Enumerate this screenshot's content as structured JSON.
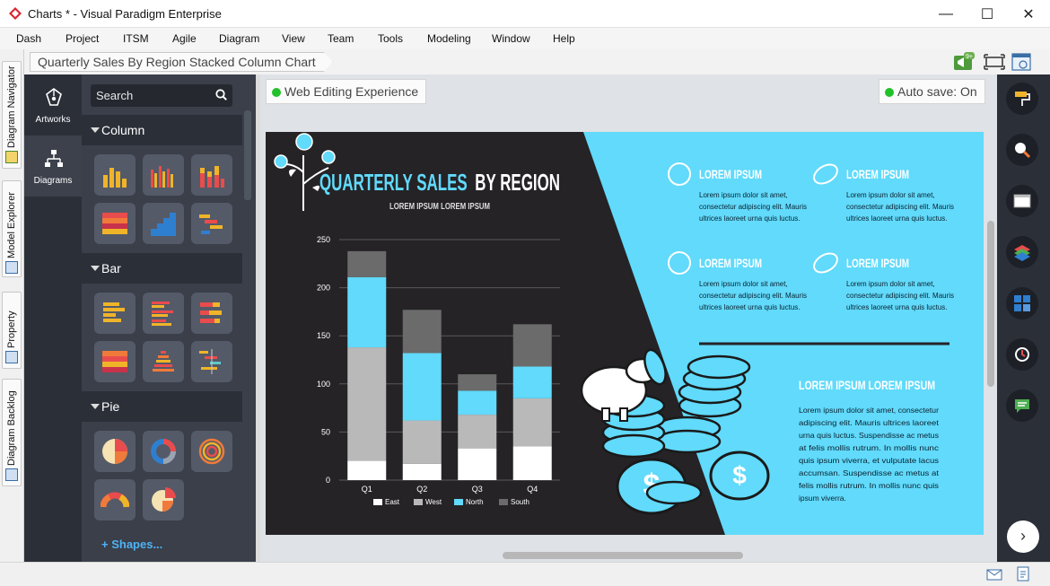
{
  "window": {
    "title": "Charts * - Visual Paradigm Enterprise",
    "controls": {
      "minimize": "—",
      "maximize": "☐",
      "close": "✕"
    }
  },
  "menu": {
    "items": [
      "Dash",
      "Project",
      "ITSM",
      "Agile",
      "Diagram",
      "View",
      "Team",
      "Tools",
      "Modeling",
      "Window",
      "Help"
    ]
  },
  "left_tabs": [
    "Diagram Navigator",
    "Model Explorer",
    "Property",
    "Diagram Backlog"
  ],
  "breadcrumb": {
    "label": "Quarterly Sales By Region Stacked Column Chart"
  },
  "toolbar": {
    "notification_badge": "9+"
  },
  "rail": {
    "artworks_label": "Artworks",
    "diagrams_label": "Diagrams"
  },
  "panel": {
    "search_placeholder": "Search",
    "categories": {
      "column": "Column",
      "bar": "Bar",
      "pie": "Pie"
    },
    "shapes_link": "+ Shapes..."
  },
  "canvas": {
    "web_editing_label": "Web Editing Experience",
    "autosave_label": "Auto save: On",
    "status_color": "#21c12a"
  },
  "infographic": {
    "title_part1": "QUARTERLY SALES",
    "title_part2": "BY REGION",
    "subtitle": "LOREM IPSUM LOREM IPSUM",
    "colors": {
      "dark": "#252326",
      "cyan": "#61dafb"
    },
    "feature_heading": "LOREM IPSUM",
    "feature_body_lines": [
      "Lorem ipsum dolor sit amet,",
      "consectetur adipiscing elit. Mauris",
      "ultrices laoreet urna quis luctus."
    ],
    "callout_heading": "LOREM IPSUM LOREM IPSUM",
    "callout_body_lines": [
      "Lorem ipsum dolor sit amet, consectetur",
      "adipiscing elit. Mauris ultrices laoreet",
      "urna quis luctus. Suspendisse ac metus",
      "at felis mollis rutrum. In mollis nunc",
      "quis ipsum viverra, et vulputate lacus",
      "accumsan. Suspendisse ac metus at",
      "felis mollis rutrum. In mollis nunc quis",
      "ipsum viverra."
    ]
  },
  "chart_data": {
    "type": "bar",
    "stacked": true,
    "categories": [
      "Q1",
      "Q2",
      "Q3",
      "Q4"
    ],
    "series": [
      {
        "name": "East",
        "color": "#ffffff",
        "values": [
          20,
          17,
          33,
          35
        ]
      },
      {
        "name": "West",
        "color": "#b9b9b9",
        "values": [
          118,
          45,
          35,
          50
        ]
      },
      {
        "name": "North",
        "color": "#61dafb",
        "values": [
          73,
          70,
          25,
          33
        ]
      },
      {
        "name": "South",
        "color": "#6b6b6b",
        "values": [
          27,
          45,
          17,
          44
        ]
      }
    ],
    "yticks": [
      0,
      50,
      100,
      150,
      200,
      250
    ],
    "ylim": [
      0,
      250
    ],
    "grid": true,
    "legend": "bottom"
  }
}
